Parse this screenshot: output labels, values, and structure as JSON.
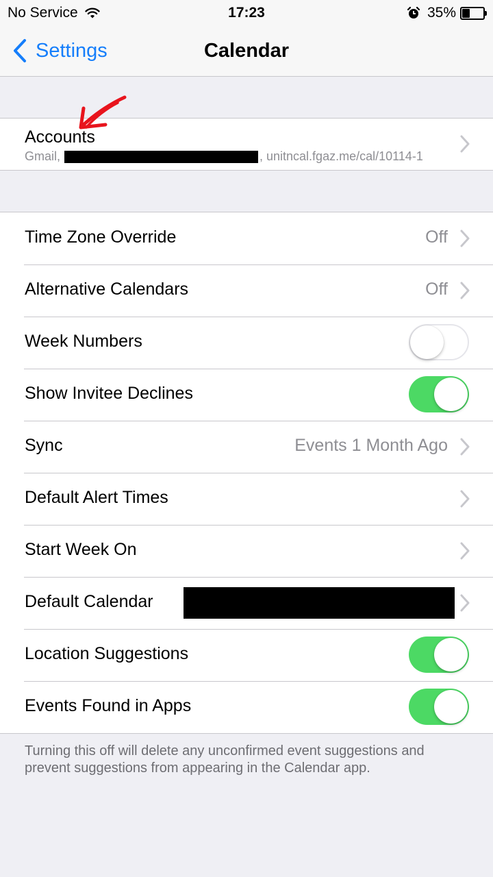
{
  "status_bar": {
    "carrier": "No Service",
    "time": "17:23",
    "battery_percent": "35%",
    "battery_level": 0.35,
    "icons": [
      "wifi-icon",
      "alarm-icon",
      "battery-icon"
    ]
  },
  "nav": {
    "back_label": "Settings",
    "title": "Calendar"
  },
  "accounts": {
    "label": "Accounts",
    "detail_prefix": "Gmail,",
    "detail_suffix": ", unitncal.fgaz.me/cal/10114-1"
  },
  "settings": {
    "time_zone_override": {
      "label": "Time Zone Override",
      "value": "Off"
    },
    "alternative_calendars": {
      "label": "Alternative Calendars",
      "value": "Off"
    },
    "week_numbers": {
      "label": "Week Numbers",
      "on": false
    },
    "show_invitee_declines": {
      "label": "Show Invitee Declines",
      "on": true
    },
    "sync": {
      "label": "Sync",
      "value": "Events 1 Month Ago"
    },
    "default_alert_times": {
      "label": "Default Alert Times"
    },
    "start_week_on": {
      "label": "Start Week On"
    },
    "default_calendar": {
      "label": "Default Calendar"
    },
    "location_suggestions": {
      "label": "Location Suggestions",
      "on": true
    },
    "events_found_in_apps": {
      "label": "Events Found in Apps",
      "on": true
    }
  },
  "footer_note": "Turning this off will delete any unconfirmed event suggestions and prevent suggestions from appearing in the Calendar app.",
  "colors": {
    "accent": "#157efb",
    "switch_on": "#4cd964",
    "background": "#efeff4",
    "annotation_arrow": "#e8141d"
  }
}
